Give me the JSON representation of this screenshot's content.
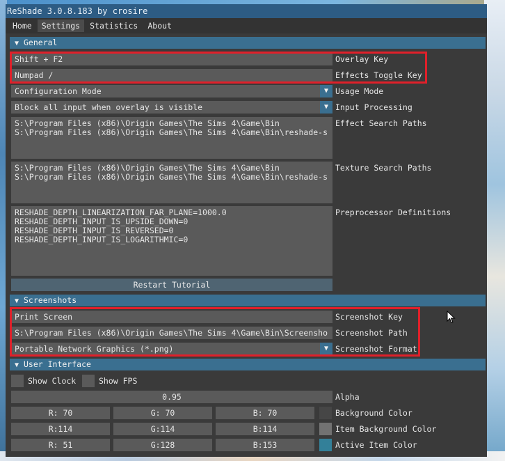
{
  "window": {
    "title": "ReShade 3.0.8.183 by crosire"
  },
  "menu": [
    {
      "label": "Home"
    },
    {
      "label": "Settings"
    },
    {
      "label": "Statistics"
    },
    {
      "label": "About"
    }
  ],
  "active_menu": "Settings",
  "general": {
    "header": "General",
    "overlay_key": {
      "value": "Shift + F2",
      "label": "Overlay Key"
    },
    "effects_toggle_key": {
      "value": "Numpad /",
      "label": "Effects Toggle Key"
    },
    "usage_mode": {
      "value": "Configuration Mode",
      "label": "Usage Mode"
    },
    "input_processing": {
      "value": "Block all input when overlay is visible",
      "label": "Input Processing"
    },
    "effect_search_paths": {
      "lines": [
        "S:\\Program Files (x86)\\Origin Games\\The Sims 4\\Game\\Bin",
        "S:\\Program Files (x86)\\Origin Games\\The Sims 4\\Game\\Bin\\reshade-s"
      ],
      "label": "Effect Search Paths"
    },
    "texture_search_paths": {
      "lines": [
        "S:\\Program Files (x86)\\Origin Games\\The Sims 4\\Game\\Bin",
        "S:\\Program Files (x86)\\Origin Games\\The Sims 4\\Game\\Bin\\reshade-s"
      ],
      "label": "Texture Search Paths"
    },
    "preprocessor_definitions": {
      "lines": [
        "RESHADE_DEPTH_LINEARIZATION_FAR_PLANE=1000.0",
        "RESHADE_DEPTH_INPUT_IS_UPSIDE_DOWN=0",
        "RESHADE_DEPTH_INPUT_IS_REVERSED=0",
        "RESHADE_DEPTH_INPUT_IS_LOGARITHMIC=0"
      ],
      "label": "Preprocessor Definitions"
    },
    "restart_tutorial": "Restart Tutorial"
  },
  "screenshots": {
    "header": "Screenshots",
    "key": {
      "value": "Print Screen",
      "label": "Screenshot Key"
    },
    "path": {
      "value": "S:\\Program Files (x86)\\Origin Games\\The Sims 4\\Game\\Bin\\Screensho",
      "label": "Screenshot Path"
    },
    "format": {
      "value": "Portable Network Graphics (*.png)",
      "label": "Screenshot Format"
    }
  },
  "user_interface": {
    "header": "User Interface",
    "show_clock": "Show Clock",
    "show_fps": "Show FPS",
    "alpha": {
      "value": "0.95",
      "label": "Alpha"
    },
    "background_color": {
      "r": "R: 70",
      "g": "G: 70",
      "b": "B: 70",
      "label": "Background Color",
      "swatch": "#464646"
    },
    "item_background_color": {
      "r": "R:114",
      "g": "G:114",
      "b": "B:114",
      "label": "Item Background Color",
      "swatch": "#727272"
    },
    "active_item_color": {
      "r": "R: 51",
      "g": "G:128",
      "b": "B:153",
      "label": "Active Item Color",
      "swatch": "#338099"
    }
  },
  "icons": {
    "collapse": "triangle-down-icon",
    "dropdown": "triangle-down-icon"
  },
  "colors": {
    "title_bar": "#2d5c84",
    "header": "#3a6f90",
    "highlight": "#e0202a"
  }
}
